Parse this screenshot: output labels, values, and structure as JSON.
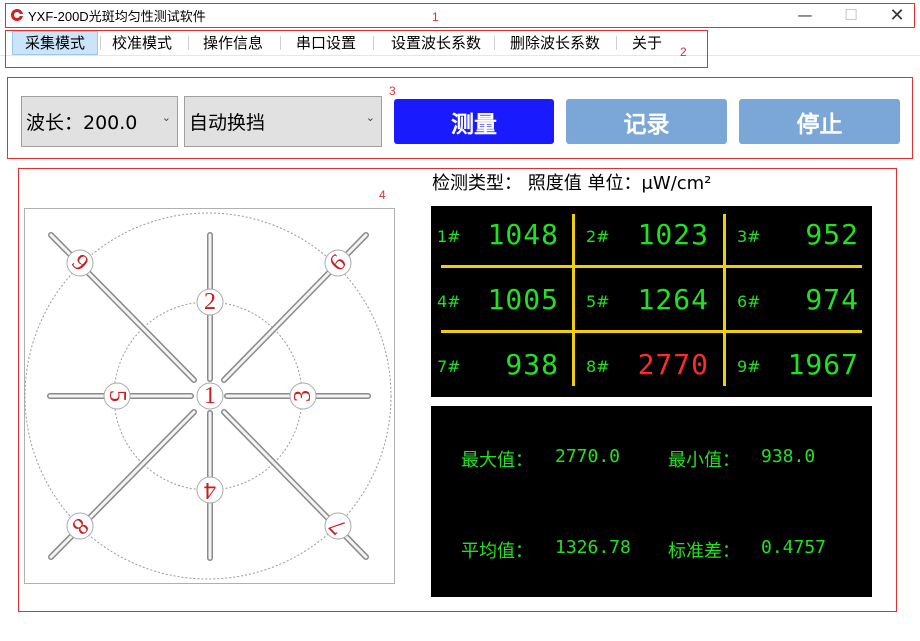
{
  "window": {
    "title": "YXF-200D光斑均匀性测试软件",
    "min": "—",
    "max": "☐",
    "close": "✕"
  },
  "annotations": [
    "1",
    "2",
    "3",
    "4"
  ],
  "menu": [
    {
      "label": "采集模式",
      "active": true
    },
    {
      "label": "校准模式"
    },
    {
      "label": "操作信息"
    },
    {
      "label": "串口设置"
    },
    {
      "label": "设置波长系数"
    },
    {
      "label": "删除波长系数"
    },
    {
      "label": "关于"
    }
  ],
  "controls": {
    "wavelength": "波长：200.0",
    "range_mode": "自动换挡",
    "measure": "测量",
    "record": "记录",
    "stop": "停止"
  },
  "detection": {
    "line": "检测类型： 照度值 单位：μW/cm²"
  },
  "diagram": {
    "points": [
      "1",
      "2",
      "3",
      "4",
      "5",
      "6",
      "7",
      "8",
      "9"
    ]
  },
  "readings": [
    {
      "label": "1#",
      "value": "1048"
    },
    {
      "label": "2#",
      "value": "1023"
    },
    {
      "label": "3#",
      "value": "952"
    },
    {
      "label": "4#",
      "value": "1005"
    },
    {
      "label": "5#",
      "value": "1264"
    },
    {
      "label": "6#",
      "value": "974"
    },
    {
      "label": "7#",
      "value": "938"
    },
    {
      "label": "8#",
      "value": "2770"
    },
    {
      "label": "9#",
      "value": "1967"
    }
  ],
  "stats": {
    "max_label": "最大值：",
    "max_value": "2770.0",
    "min_label": "最小值：",
    "min_value": "938.0",
    "avg_label": "平均值：",
    "avg_value": "1326.78",
    "std_label": "标准差：",
    "std_value": "0.4757"
  },
  "colors": {
    "measure_btn": "#1a1aff",
    "disabled_btn": "#7aa6d8",
    "digit_green": "#22e022",
    "digit_red": "#ff2a2a",
    "grid_yellow": "#f0d000",
    "annotation_red": "#e03030"
  }
}
